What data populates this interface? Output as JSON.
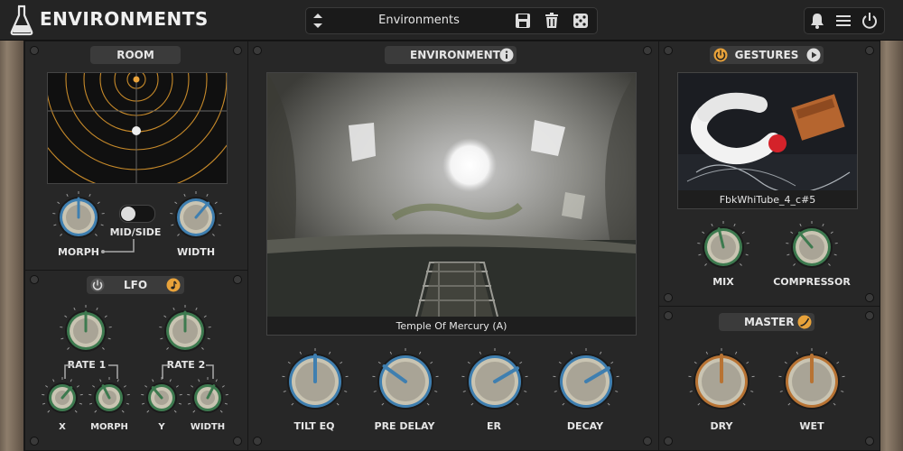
{
  "header": {
    "app_title": "ENVIRONMENTS",
    "preset_name": "Environments",
    "icons": [
      "flask-icon",
      "preset-prev-next-icon",
      "save-icon",
      "trash-icon",
      "dice-icon",
      "bell-icon",
      "menu-icon",
      "power-icon"
    ]
  },
  "room": {
    "title": "ROOM",
    "mid_side_label": "MID/SIDE",
    "mid_side_on": false,
    "knobs": [
      {
        "label": "MORPH",
        "value": 0.5
      },
      {
        "label": "WIDTH",
        "value": 0.65
      }
    ]
  },
  "lfo": {
    "title": "LFO",
    "rate1_label": "RATE 1",
    "rate2_label": "RATE 2",
    "knobs": [
      {
        "label": "X",
        "value": 0.65
      },
      {
        "label": "MORPH",
        "value": 0.4
      },
      {
        "label": "Y",
        "value": 0.35
      },
      {
        "label": "WIDTH",
        "value": 0.6
      }
    ]
  },
  "environment": {
    "title": "ENVIRONMENT",
    "image_caption": "Temple Of Mercury (A)",
    "knobs": [
      {
        "label": "TILT EQ",
        "value": 0.5
      },
      {
        "label": "PRE DELAY",
        "value": 0.3
      },
      {
        "label": "ER",
        "value": 0.72
      },
      {
        "label": "DECAY",
        "value": 0.72
      }
    ]
  },
  "gestures": {
    "title": "GESTURES",
    "image_caption": "FbkWhiTube_4_c#5",
    "knobs": [
      {
        "label": "MIX",
        "value": 0.45
      },
      {
        "label": "COMPRESSOR",
        "value": 0.35
      }
    ]
  },
  "master": {
    "title": "MASTER",
    "knobs": [
      {
        "label": "DRY",
        "value": 0.5
      },
      {
        "label": "WET",
        "value": 0.5
      }
    ]
  },
  "colors": {
    "accent": "#e8a23a",
    "knob_blue": "#3f7fb0",
    "knob_green": "#3d7a4f",
    "knob_copper": "#b87333"
  }
}
